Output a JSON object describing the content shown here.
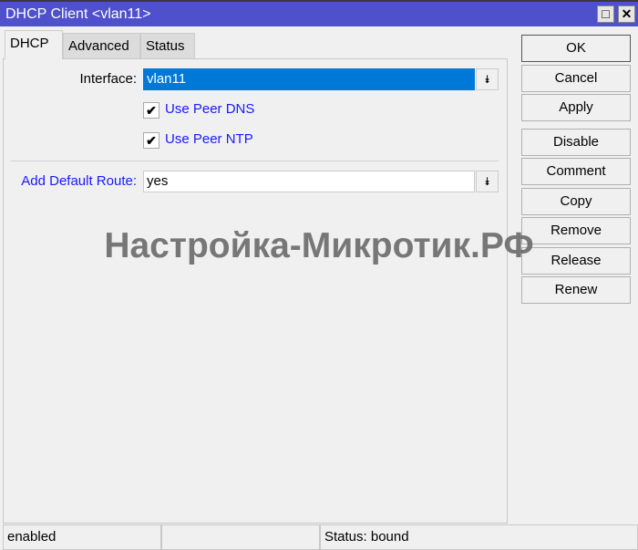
{
  "window": {
    "title": "DHCP Client <vlan11>",
    "maximize_icon": "□",
    "close_icon": "✕"
  },
  "tabs": [
    {
      "label": "DHCP"
    },
    {
      "label": "Advanced"
    },
    {
      "label": "Status"
    }
  ],
  "form": {
    "interface_label": "Interface:",
    "interface_value": "vlan11",
    "use_peer_dns_label": "Use Peer DNS",
    "use_peer_dns_checked": true,
    "use_peer_ntp_label": "Use Peer NTP",
    "use_peer_ntp_checked": true,
    "add_default_route_label": "Add Default Route:",
    "add_default_route_value": "yes",
    "check_glyph": "✔",
    "dropdown_glyph": "⯯"
  },
  "buttons": {
    "ok": "OK",
    "cancel": "Cancel",
    "apply": "Apply",
    "disable": "Disable",
    "comment": "Comment",
    "copy": "Copy",
    "remove": "Remove",
    "release": "Release",
    "renew": "Renew"
  },
  "watermark": "Настройка-Микротик.РФ",
  "statusbar": {
    "state": "enabled",
    "middle": "",
    "status": "Status: bound"
  },
  "colors": {
    "titlebar": "#4e50cc",
    "selection": "#0078d7",
    "link_label": "#1a1aff"
  }
}
